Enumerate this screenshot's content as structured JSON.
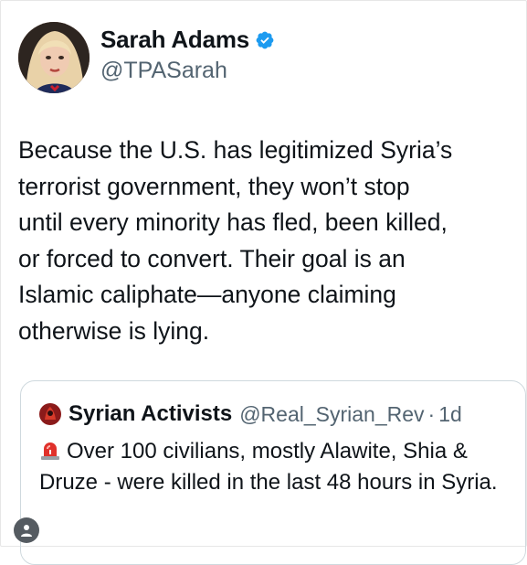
{
  "tweet": {
    "display_name": "Sarah Adams",
    "handle": "@TPASarah",
    "text": "Because the U.S. has legitimized Syria’s\nterrorist government, they won’t stop\nuntil every minority has fled, been killed,\nor forced to convert. Their goal is an\nIslamic caliphate—anyone claiming\notherwise is lying."
  },
  "quote": {
    "display_name": "Syrian Activists",
    "handle": "@Real_Syrian_Rev",
    "separator": "·",
    "time": "1d",
    "text": "Over 100 civilians, mostly Alawite, Shia & Druze - were killed in the last 48 hours in Syria."
  },
  "icons": {
    "verified": "verified-badge-icon",
    "siren": "siren-emoji-icon",
    "user": "user-icon"
  },
  "colors": {
    "verified_blue": "#1d9bf0",
    "secondary_text": "#536471",
    "border": "#cfd9de"
  }
}
